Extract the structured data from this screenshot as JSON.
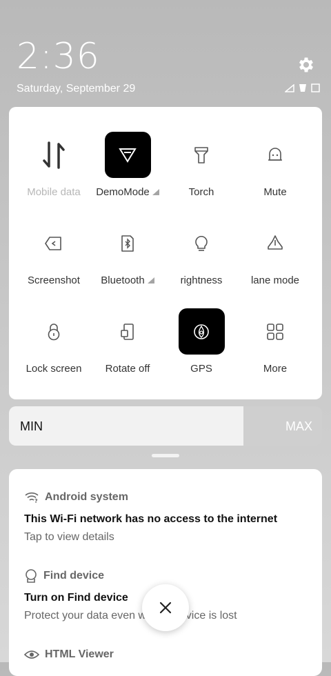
{
  "status": {
    "time": "2:36",
    "date": "Saturday, September 29"
  },
  "quick_settings": {
    "tiles": [
      {
        "label": "Mobile data",
        "icon": "mobile-data-icon",
        "active": false,
        "dim": true
      },
      {
        "label": "DemoMode",
        "icon": "demo-mode-icon",
        "active": true,
        "has_more": true
      },
      {
        "label": "Torch",
        "icon": "torch-icon",
        "active": false
      },
      {
        "label": "Mute",
        "icon": "bell-icon",
        "active": false
      },
      {
        "label": "Screenshot",
        "icon": "screenshot-icon",
        "active": false
      },
      {
        "label": "Bluetooth",
        "icon": "bluetooth-icon",
        "active": false,
        "has_more": true
      },
      {
        "label": "rightness",
        "icon": "brightness-bulb-icon",
        "active": false
      },
      {
        "label": "lane mode",
        "icon": "airplane-icon",
        "active": false
      },
      {
        "label": "Lock screen",
        "icon": "lock-icon",
        "active": false
      },
      {
        "label": "Rotate off",
        "icon": "rotate-icon",
        "active": false
      },
      {
        "label": "GPS",
        "icon": "gps-icon",
        "active": true
      },
      {
        "label": "More",
        "icon": "grid-icon",
        "active": false
      }
    ]
  },
  "brightness": {
    "min_label": "MIN",
    "max_label": "MAX",
    "level_percent": 75
  },
  "notifications": [
    {
      "app": "Android system",
      "icon": "wifi-question-icon",
      "title": "This Wi-Fi network has no access to the internet",
      "body": "Tap to view details"
    },
    {
      "app": "Find device",
      "icon": "location-pin-icon",
      "title": "Turn on Find device",
      "body": "Protect your data even w         device is lost"
    },
    {
      "app": "HTML Viewer",
      "icon": "eye-icon",
      "title": "",
      "body": ""
    }
  ],
  "colors": {
    "active_tile": "#000000",
    "panel": "#ffffff",
    "background": "#c4c4c4"
  }
}
